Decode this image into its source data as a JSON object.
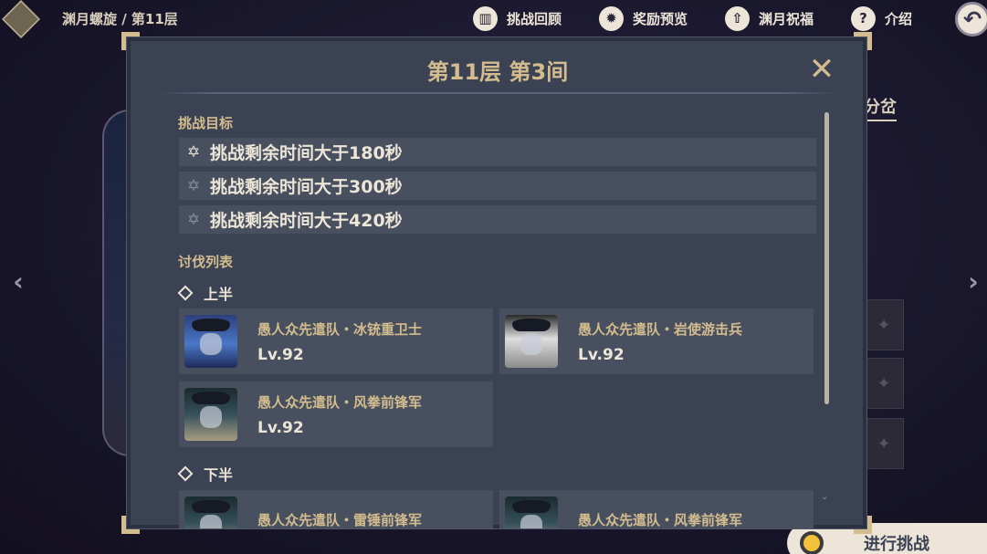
{
  "topbar": {
    "breadcrumb": "渊月螺旋 / 第11层",
    "actions": [
      {
        "label": "挑战回顾",
        "icon": "book-icon"
      },
      {
        "label": "奖励预览",
        "icon": "gear-star-icon"
      },
      {
        "label": "渊月祝福",
        "icon": "upload-icon"
      },
      {
        "label": "介绍",
        "icon": "help-icon"
      }
    ],
    "help_glyph": "?",
    "back_glyph": "↶"
  },
  "background": {
    "branch_tab": "分岔",
    "start_button": "进行挑战"
  },
  "modal": {
    "title": "第11层 第3间",
    "close_glyph": "✕",
    "goals_label": "挑战目标",
    "goals": [
      {
        "text": "挑战剩余时间大于180秒",
        "achieved": true
      },
      {
        "text": "挑战剩余时间大于300秒",
        "achieved": false
      },
      {
        "text": "挑战剩余时间大于420秒",
        "achieved": false
      }
    ],
    "enemies_label": "讨伐列表",
    "first_half": {
      "label": "上半",
      "enemies": [
        {
          "name": "愚人众先遣队・冰铳重卫士",
          "level": "Lv.92",
          "portrait": "cryo-gunner"
        },
        {
          "name": "愚人众先遣队・岩使游击兵",
          "level": "Lv.92",
          "portrait": "geochanter"
        },
        {
          "name": "愚人众先遣队・风拳前锋军",
          "level": "Lv.92",
          "portrait": "anemoboxer"
        }
      ]
    },
    "second_half": {
      "label": "下半",
      "enemies": [
        {
          "name": "愚人众先遣队・雷锤前锋军",
          "level": "",
          "portrait": "electro-hammer"
        },
        {
          "name": "愚人众先遣队・风拳前锋军",
          "level": "",
          "portrait": "anemoboxer"
        }
      ]
    }
  },
  "colors": {
    "accent_gold": "#d3bc8e",
    "panel_bg": "#3a4253",
    "row_bg": "#48505f",
    "text_light": "#ece5d8"
  }
}
